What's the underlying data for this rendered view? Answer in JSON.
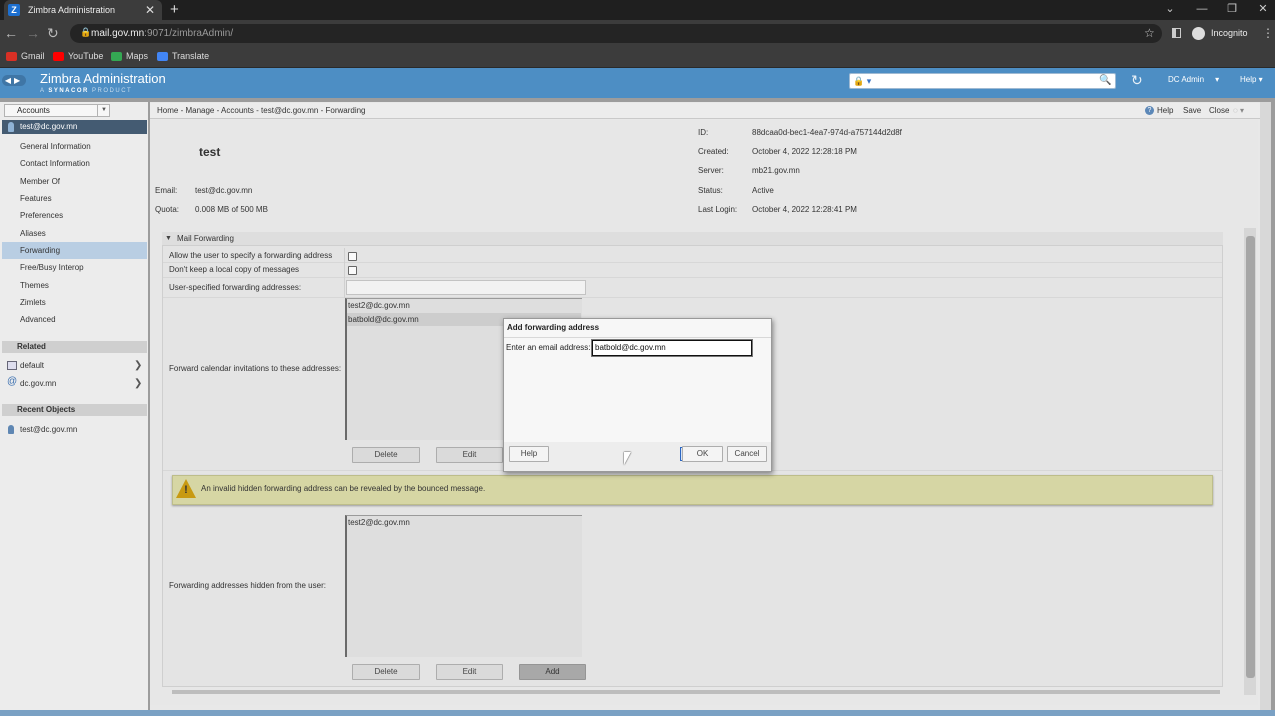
{
  "browser": {
    "tab_title": "Zimbra Administration",
    "tab_favicon": "Z",
    "url_host": "mail.gov.mn",
    "url_path": ":9071/zimbraAdmin/",
    "profile_label": "Incognito",
    "bookmarks": [
      "Gmail",
      "YouTube",
      "Maps",
      "Translate"
    ],
    "icons": {
      "back": "arrow-left-icon",
      "forward": "arrow-right-icon",
      "reload": "reload-icon",
      "star": "star-icon"
    }
  },
  "app": {
    "title": "Zimbra Administration",
    "subtitle_prefix": "A ",
    "subtitle_brand": "SYNACOR",
    "subtitle_suffix": " PRODUCT",
    "admin_menu": "DC Admin",
    "help_menu": "Help",
    "accent": "#4d8ec4"
  },
  "sidebar": {
    "dropdown_label": "Accounts",
    "selected_account": "test@dc.gov.mn",
    "items": [
      {
        "label": "General Information"
      },
      {
        "label": "Contact Information"
      },
      {
        "label": "Member Of"
      },
      {
        "label": "Features"
      },
      {
        "label": "Preferences"
      },
      {
        "label": "Aliases"
      },
      {
        "label": "Forwarding",
        "selected": true
      },
      {
        "label": "Free/Busy Interop"
      },
      {
        "label": "Themes"
      },
      {
        "label": "Zimlets"
      },
      {
        "label": "Advanced"
      }
    ],
    "related_title": "Related",
    "related": [
      {
        "label": "default"
      },
      {
        "label": "dc.gov.mn"
      }
    ],
    "recent_title": "Recent Objects",
    "recent": [
      {
        "label": "test@dc.gov.mn"
      }
    ]
  },
  "toolbar": {
    "breadcrumb": "Home - Manage - Accounts - test@dc.gov.mn - Forwarding",
    "help": "Help",
    "save": "Save",
    "close": "Close"
  },
  "account": {
    "name": "test",
    "email_label": "Email:",
    "email": "test@dc.gov.mn",
    "quota_label": "Quota:",
    "quota": "0.008 MB of 500 MB",
    "id_label": "ID:",
    "id": "88dcaa0d-bec1-4ea7-974d-a757144d2d8f",
    "created_label": "Created:",
    "created": "October 4, 2022 12:28:18 PM",
    "server_label": "Server:",
    "server": "mb21.gov.mn",
    "status_label": "Status:",
    "status": "Active",
    "lastlogin_label": "Last Login:",
    "lastlogin": "October 4, 2022 12:28:41 PM"
  },
  "forwarding": {
    "section_title": "Mail Forwarding",
    "allow_user_label": "Allow the user to specify a forwarding address",
    "allow_user_checked": false,
    "no_local_copy_label": "Don't keep a local copy of messages",
    "no_local_copy_checked": false,
    "user_specified_label": "User-specified forwarding addresses:",
    "user_specified_value": "",
    "calendar_label": "Forward calendar invitations to these addresses:",
    "calendar_addresses": [
      "test2@dc.gov.mn",
      "batbold@dc.gov.mn"
    ],
    "calendar_delete": "Delete",
    "calendar_edit": "Edit",
    "warning_text": "An invalid hidden forwarding address can be revealed by the bounced message.",
    "hidden_label": "Forwarding addresses hidden from the user:",
    "hidden_addresses": [
      "test2@dc.gov.mn"
    ],
    "hidden_delete": "Delete",
    "hidden_edit": "Edit",
    "hidden_add": "Add"
  },
  "dialog": {
    "title": "Add forwarding address",
    "field_label": "Enter an email address:",
    "field_value": "batbold@dc.gov.mn",
    "help": "Help",
    "ok": "OK",
    "cancel": "Cancel"
  }
}
